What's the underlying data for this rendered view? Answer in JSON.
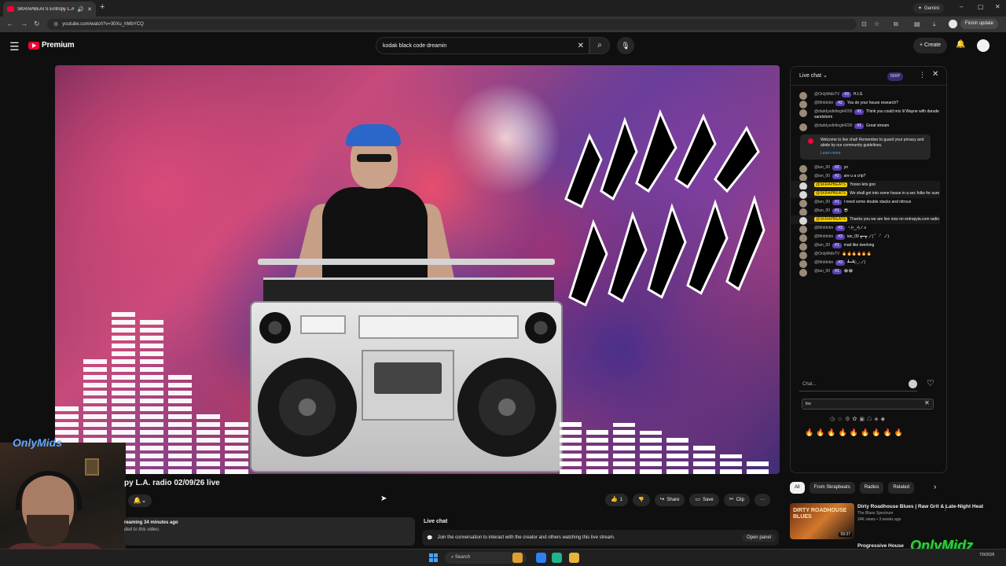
{
  "browser": {
    "tab_title": "SKRAPBEATS Entropy L.A.",
    "url": "youtube.com/watch?v=30Xu_hMbYCQ",
    "gemini_label": "Gemini",
    "finish_update_label": "Finish update"
  },
  "header": {
    "logo_text": "Premium",
    "search_query": "kodak black code dreamin",
    "create_label": "Create"
  },
  "video": {
    "title": "py L.A. radio 02/09/26 live",
    "description_line1": "reaming 34 minutes ago",
    "description_line2": "ded to this video."
  },
  "actions": {
    "like_count": "1",
    "share_label": "Share",
    "save_label": "Save",
    "clip_label": "Clip"
  },
  "live_chat_box": {
    "heading": "Live chat",
    "body": "Join the conversation to interact with the creator and others watching this live stream.",
    "open_label": "Open panel"
  },
  "chat": {
    "title": "Live chat",
    "xp_label": "50XP",
    "welcome_text": "Welcome to live chat! Remember to guard your privacy and abide by our community guidelines.",
    "learn_more": "Learn more",
    "input_placeholder": "Chat...",
    "typed_text": "fire",
    "messages": [
      {
        "author": "@OnlyMidsTV",
        "badge": "#3",
        "text": "H.I.G",
        "owner": false
      },
      {
        "author": "@Mnldnbn",
        "badge": "#2",
        "text": "You do your house research?",
        "owner": false
      },
      {
        "author": "@daddysdirtlegit4200",
        "badge": "#1",
        "text": "Think you could mix lil Wayne with darude sandstorm",
        "owner": false
      },
      {
        "author": "@daddysdirtlegit4200",
        "badge": "#1",
        "text": "Great stream",
        "owner": false
      },
      {
        "author": "@ian_00",
        "badge": "#2",
        "text": "yo",
        "owner": false
      },
      {
        "author": "@ian_00",
        "badge": "#2",
        "text": "are u a crip?",
        "owner": false
      },
      {
        "author": "@SKRAPBEATS",
        "badge": "",
        "text": "Yoooo lets goo",
        "owner": true
      },
      {
        "author": "@SKRAPBEATS",
        "badge": "",
        "text": "We shall get into some house in a sec folks for sure",
        "owner": true
      },
      {
        "author": "@ian_00",
        "badge": "#1",
        "text": "I need some double stacks and nitrous",
        "owner": false
      },
      {
        "author": "@ian_00",
        "badge": "#1",
        "text": "😎",
        "owner": false
      },
      {
        "author": "@SKRAPBEATS",
        "badge": "",
        "text": "Thanks you we are live now on entropyla.com radio",
        "owner": true
      },
      {
        "author": "@Mnldnbn",
        "badge": "#3",
        "text": "ヽ(•‿•)ノ♬",
        "owner": false
      },
      {
        "author": "@Mnldnbn",
        "badge": "#3",
        "text": "ian_00 ┳━┳ ノ( ゜-゜ノ)",
        "owner": false
      },
      {
        "author": "@ian_00",
        "badge": "#1",
        "text": "mad like twerking",
        "owner": false
      },
      {
        "author": "@OnlyMidsTV",
        "badge": "",
        "text": "🔥🔥🔥🔥🔥🔥",
        "owner": false
      },
      {
        "author": "@Mnldnbn",
        "badge": "#3",
        "text": "┻━┻(-_-ノ)",
        "owner": false
      },
      {
        "author": "@ian_00",
        "badge": "#1",
        "text": "😂😂",
        "owner": false
      }
    ]
  },
  "chips": [
    {
      "label": "All",
      "active": true
    },
    {
      "label": "From Skrapbeats",
      "active": false
    },
    {
      "label": "Radios",
      "active": false
    },
    {
      "label": "Related",
      "active": false
    }
  ],
  "recommendation": {
    "thumb_title": "DIRTY ROADHOUSE BLUES",
    "duration": "59:37",
    "title": "Dirty Roadhouse Blues | Raw Grit & Late-Night Heat",
    "channel": "The Blues Spectrum",
    "meta": "24K views • 3 weeks ago",
    "next_title": "Progressive House"
  },
  "overlay": {
    "watermark_left": "OnlyMids",
    "watermark_right": "OnlyMidz"
  },
  "taskbar": {
    "search_label": "Search",
    "clock": "7/9/2026"
  },
  "colors": {
    "accent_red": "#ff0033",
    "link_blue": "#3ea6ff",
    "owner_badge": "#ffd600",
    "member_badge": "#5b3fb7"
  }
}
